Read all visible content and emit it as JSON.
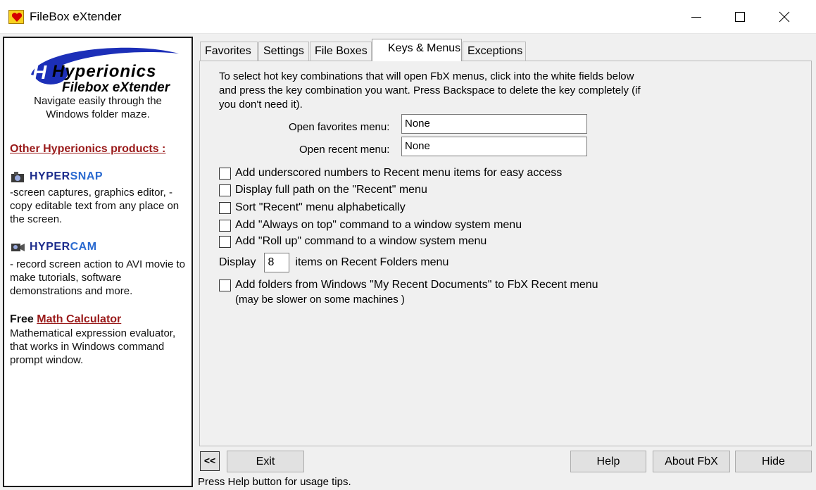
{
  "window": {
    "title": "FileBox eXtender"
  },
  "left_panel": {
    "logo_text_1": "Hyperionics",
    "logo_text_2": "Filebox eXtender",
    "nav_desc": "Navigate easily through the Windows folder maze.",
    "other_products": "Other Hyperionics products :",
    "products": [
      {
        "name_a": "HYPER",
        "name_b": "SNAP",
        "desc": "-screen captures, graphics editor, - copy editable text from any place on the screen."
      },
      {
        "name_a": "HYPER",
        "name_b": "CAM",
        "desc": "- record screen action to AVI movie to make tutorials, software demonstrations and more."
      }
    ],
    "free_label": "Free",
    "math_link": "Math Calculator",
    "math_desc": "Mathematical expression evaluator, that works in Windows command prompt window."
  },
  "tabs": [
    {
      "label": "Favorites"
    },
    {
      "label": "Settings"
    },
    {
      "label": "File Boxes"
    },
    {
      "label": "Keys & Menus"
    },
    {
      "label": "Exceptions"
    }
  ],
  "keys_menus": {
    "intro": "To select hot key combinations that will open FbX menus, click into the white fields below and press the key combination you want. Press Backspace to delete the key completely (if you don't need it).",
    "fav_label": "Open favorites menu:",
    "fav_value": "None",
    "recent_label": "Open recent menu:",
    "recent_value": "None",
    "checkboxes": [
      {
        "label": "Add underscored numbers to Recent menu items for easy access"
      },
      {
        "label": "Display full path on the \"Recent\" menu"
      },
      {
        "label": "Sort \"Recent\" menu alphabetically"
      },
      {
        "label": "Add \"Always on top\" command to a window system menu"
      },
      {
        "label": "Add \"Roll up\" command to a window system menu"
      }
    ],
    "display_label": "Display",
    "display_value": "8",
    "display_suffix": "items on Recent Folders menu",
    "recent_docs_label": "Add folders from Windows \"My Recent Documents\" to FbX Recent menu",
    "recent_docs_note": "(may be slower on some machines )"
  },
  "buttons": {
    "collapse": "<<",
    "exit": "Exit",
    "help": "Help",
    "about": "About FbX",
    "hide": "Hide"
  },
  "status": "Press Help button for usage tips."
}
